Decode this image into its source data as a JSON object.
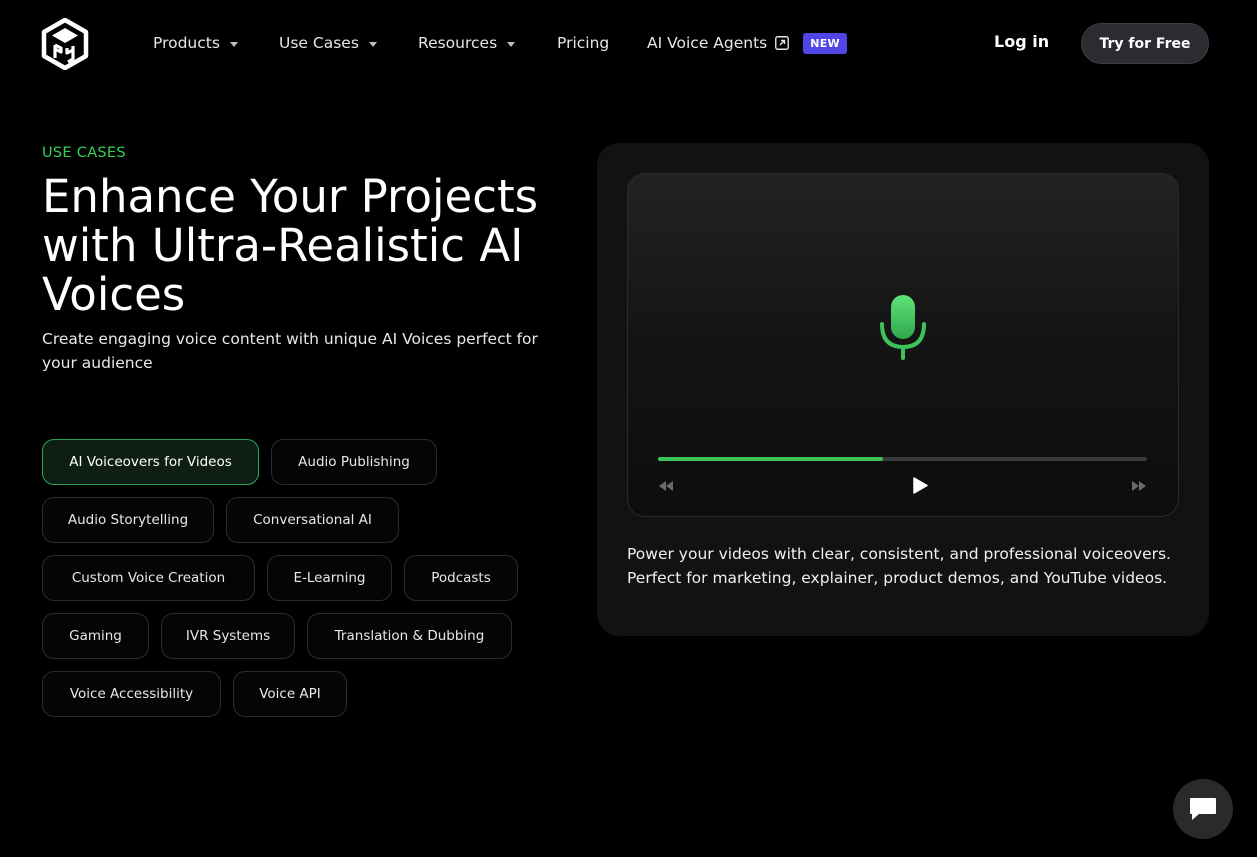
{
  "nav": {
    "items": [
      {
        "label": "Products",
        "has_caret": true
      },
      {
        "label": "Use Cases",
        "has_caret": true
      },
      {
        "label": "Resources",
        "has_caret": true
      },
      {
        "label": "Pricing",
        "has_caret": false
      },
      {
        "label": "AI Voice Agents",
        "has_caret": false
      }
    ],
    "badge": "NEW",
    "login": "Log in",
    "cta": "Try for Free"
  },
  "hero": {
    "eyebrow": "USE CASES",
    "headline": "Enhance Your Projects with Ultra-Realistic AI Voices",
    "subhead": "Create engaging voice content with unique AI Voices perfect for your audience"
  },
  "chips": [
    {
      "label": "AI Voiceovers for Videos",
      "active": true
    },
    {
      "label": "Audio Publishing",
      "active": false
    },
    {
      "label": "Audio Storytelling",
      "active": false
    },
    {
      "label": "Conversational AI",
      "active": false
    },
    {
      "label": "Custom Voice Creation",
      "active": false
    },
    {
      "label": "E-Learning",
      "active": false
    },
    {
      "label": "Podcasts",
      "active": false
    },
    {
      "label": "Gaming",
      "active": false
    },
    {
      "label": "IVR Systems",
      "active": false
    },
    {
      "label": "Translation & Dubbing",
      "active": false
    },
    {
      "label": "Voice Accessibility",
      "active": false
    },
    {
      "label": "Voice API",
      "active": false
    }
  ],
  "player": {
    "progress": 0.46,
    "icons": [
      "microphone-icon",
      "rewind-icon",
      "play-icon",
      "fast-forward-icon"
    ]
  },
  "card": {
    "description": "Power your videos with clear, consistent, and professional voiceovers. Perfect for marketing, explainer, product demos, and YouTube videos."
  },
  "colors": {
    "accent_green": "#34d058",
    "badge_purple": "#4f46e5",
    "background": "#000000",
    "card": "#121212"
  }
}
